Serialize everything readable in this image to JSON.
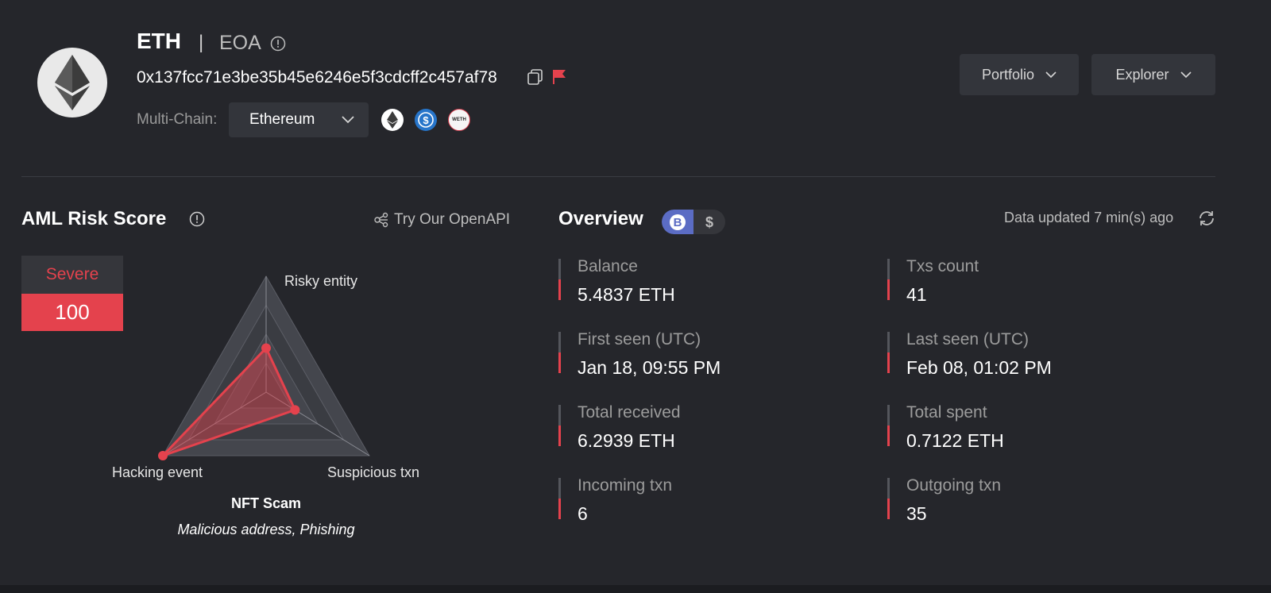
{
  "header": {
    "asset": "ETH",
    "separator": "|",
    "account_type": "EOA",
    "address": "0x137fcc71e3be35b45e6246e5f3cdcff2c457af78",
    "chain_label": "Multi-Chain:",
    "chain_selected": "Ethereum",
    "tokens": [
      "ethereum-icon",
      "usdc-icon",
      "weth-icon"
    ],
    "weth_text": "WETH",
    "portfolio_label": "Portfolio",
    "explorer_label": "Explorer"
  },
  "aml": {
    "title": "AML Risk Score",
    "openapi_label": "Try Our OpenAPI",
    "severity": "Severe",
    "score": "100",
    "radar": {
      "axes": [
        "Risky entity",
        "Suspicious txn",
        "Hacking event"
      ],
      "values": [
        0.38,
        0.28,
        1.0
      ],
      "levels": 4
    },
    "category": "NFT Scam",
    "tags": "Malicious address, Phishing"
  },
  "overview": {
    "title": "Overview",
    "updated": "Data updated 7 min(s) ago",
    "stats_left": [
      {
        "label": "Balance",
        "value": "5.4837 ETH"
      },
      {
        "label": "First seen (UTC)",
        "value": "Jan 18, 09:55 PM"
      },
      {
        "label": "Total received",
        "value": "6.2939 ETH"
      },
      {
        "label": "Incoming txn",
        "value": "6"
      }
    ],
    "stats_right": [
      {
        "label": "Txs count",
        "value": "41"
      },
      {
        "label": "Last seen (UTC)",
        "value": "Feb 08, 01:02 PM"
      },
      {
        "label": "Total spent",
        "value": "0.7122 ETH"
      },
      {
        "label": "Outgoing txn",
        "value": "35"
      }
    ]
  },
  "colors": {
    "background": "#25262b",
    "accent_red": "#e4424d",
    "toggle_active": "#5b6cc4"
  }
}
